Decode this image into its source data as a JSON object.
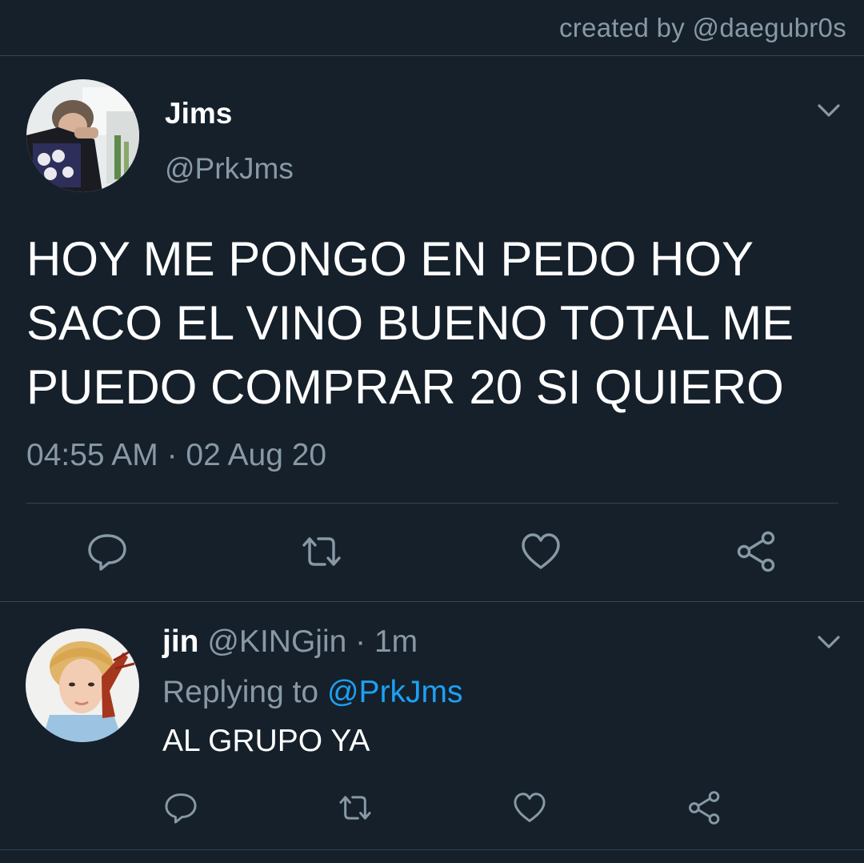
{
  "header": {
    "credit": "created by @daegubr0s"
  },
  "main_tweet": {
    "display_name": "Jims",
    "handle": "@PrkJms",
    "lines": [
      "HOY ME PONGO EN PEDO HOY",
      "SACO EL VINO BUENO TOTAL ME",
      "PUEDO COMPRAR 20 SI QUIERO"
    ],
    "timestamp": "04:55 AM · 02 Aug 20",
    "avatar_icon": "user-photo-avatar",
    "actions": [
      "reply-icon",
      "retweet-icon",
      "like-icon",
      "share-icon"
    ]
  },
  "reply_tweet": {
    "display_name": "jin",
    "meta": "@KINGjin · 1m",
    "replying_prefix": "Replying to",
    "replying_mention": "@PrkJms",
    "text": "AL GRUPO YA",
    "avatar_icon": "user-photo-avatar",
    "actions": [
      "reply-icon",
      "retweet-icon",
      "like-icon",
      "share-icon"
    ]
  },
  "colors": {
    "background": "#15202b",
    "divider": "#38444d",
    "secondary_text": "#8899a6",
    "accent": "#1da1f2",
    "primary_text": "#ffffff"
  }
}
